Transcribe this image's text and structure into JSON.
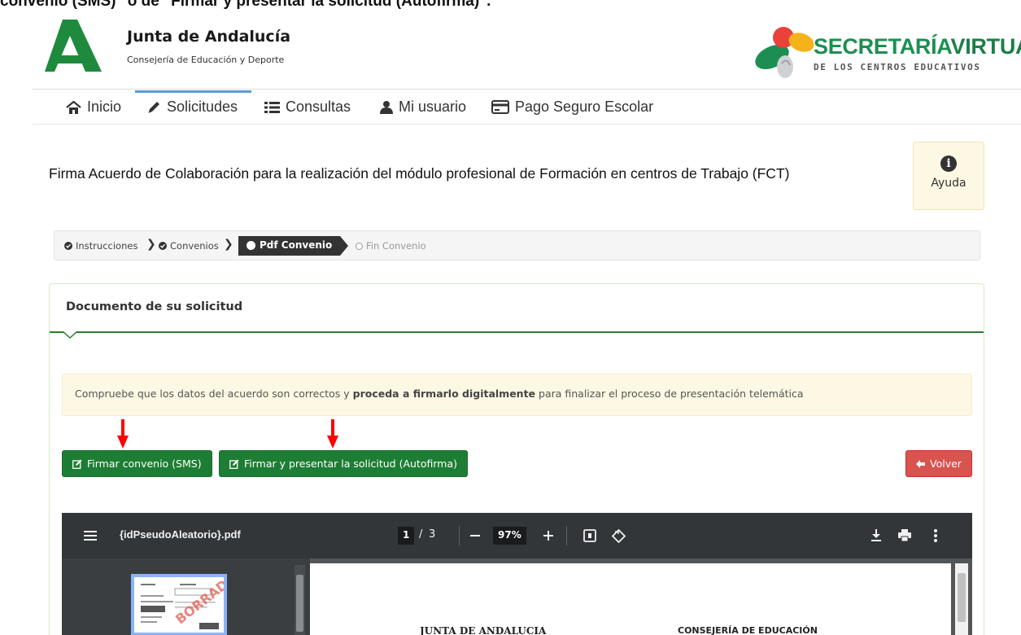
{
  "caption": {
    "line": "convenio (SMS)\" o de \"Firmar y presentar la solicitud (Autofirma)\"."
  },
  "header": {
    "org_title": "Junta de Andalucía",
    "org_subtitle": "Consejería de Educación y Deporte",
    "brand_title_a": "SECRETARÍA",
    "brand_title_b": "VIRTUAL",
    "brand_subtitle": "DE LOS CENTROS EDUCATIVOS",
    "colors": {
      "junta_green": "#1e8a3e",
      "brand_green": "#1d8e52",
      "brand_red": "#e8423b",
      "brand_yellow": "#f6b21b"
    }
  },
  "nav": {
    "items": [
      {
        "label": "Inicio",
        "icon": "home-icon"
      },
      {
        "label": "Solicitudes",
        "icon": "pencil-icon",
        "active": true
      },
      {
        "label": "Consultas",
        "icon": "list-icon"
      },
      {
        "label": "Mi usuario",
        "icon": "user-icon"
      },
      {
        "label": "Pago Seguro Escolar",
        "icon": "credit-card-icon"
      }
    ],
    "active_color": "#5b9bd5"
  },
  "page": {
    "title": "Firma Acuerdo de Colaboración para la realización del módulo profesional de Formación en centros de Trabajo (FCT)",
    "help_label": "Ayuda"
  },
  "steps": {
    "items": [
      {
        "label": "Instrucciones",
        "state": "done"
      },
      {
        "label": "Convenios",
        "state": "done"
      },
      {
        "label": "Pdf Convenio",
        "state": "current"
      },
      {
        "label": "Fin Convenio",
        "state": "pending"
      }
    ]
  },
  "panel": {
    "title": "Documento de su solicitud",
    "alert": {
      "before": "Compruebe que los datos del acuerdo son correctos y ",
      "bold": "proceda a firmarlo digitalmente",
      "after": " para finalizar el proceso de presentación telemática"
    },
    "buttons": {
      "sign_sms": "Firmar convenio (SMS)",
      "sign_autofirma": "Firmar y presentar la solicitud (Autofirma)",
      "back": "Volver"
    },
    "colors": {
      "primary_green": "#1e7d34",
      "danger_red": "#d9534f",
      "annotation_arrow": "#ff0000"
    }
  },
  "pdf_viewer": {
    "filename": "{idPseudoAleatorio}.pdf",
    "current_page": "1",
    "page_separator": "/",
    "total_pages": "3",
    "zoom": "97%",
    "page_text_left": "JUNTA DE ANDALUCIA",
    "page_text_right": "CONSEJERÍA DE EDUCACIÓN",
    "thumbnail_stamp": "BORRADOR"
  }
}
